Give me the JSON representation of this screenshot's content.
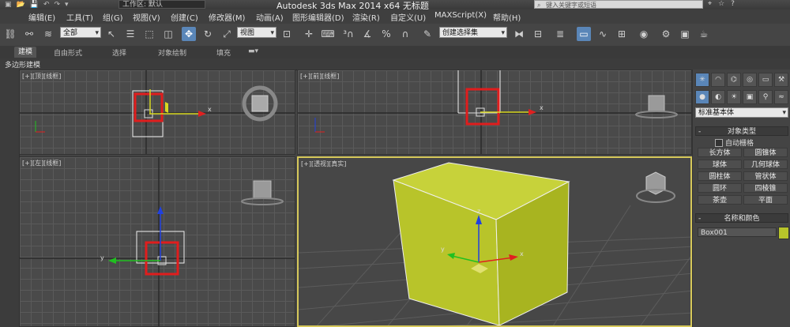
{
  "titlebar": {
    "workspace": "工作区: 默认",
    "app_title": "Autodesk 3ds Max  2014 x64      无标题",
    "search_placeholder": "键入关键字或短语",
    "quick_access": [
      "▣",
      "📂",
      "💾",
      "↶",
      "↷",
      "▾"
    ]
  },
  "menus": [
    "编辑(E)",
    "工具(T)",
    "组(G)",
    "视图(V)",
    "创建(C)",
    "修改器(M)",
    "动画(A)",
    "图形编辑器(D)",
    "渲染(R)",
    "自定义(U)",
    "MAXScript(X)",
    "帮助(H)"
  ],
  "toolbar": {
    "selection_filter": "全部",
    "ref_coord": "视图",
    "named_selection": "创建选择集"
  },
  "ribbon": {
    "tabs": [
      "建模",
      "自由形式",
      "选择",
      "对象绘制",
      "填充"
    ],
    "active_tab": "建模",
    "sub_label": "多边形建模"
  },
  "viewports": {
    "top": "[+][顶][线框]",
    "front": "[+][前][线框]",
    "left": "[+][左][线框]",
    "perspective": "[+][透视][真实]"
  },
  "axis_labels": {
    "x": "x",
    "y": "y"
  },
  "command_panel": {
    "dropdown": "标准基本体",
    "object_type_header": "对象类型",
    "auto_grid": "自动栅格",
    "buttons": [
      "长方体",
      "圆锥体",
      "球体",
      "几何球体",
      "圆柱体",
      "管状体",
      "圆环",
      "四棱锥",
      "茶壶",
      "平面"
    ],
    "name_color_header": "名称和颜色",
    "object_name": "Box001",
    "object_color": "#b8c42a"
  },
  "colors": {
    "box": "#b8c42a",
    "selection_bracket": "#e01d1d",
    "active_border": "#d6c85a",
    "axis_x": "#e02020",
    "axis_y": "#20c020",
    "axis_z": "#2040e0"
  }
}
